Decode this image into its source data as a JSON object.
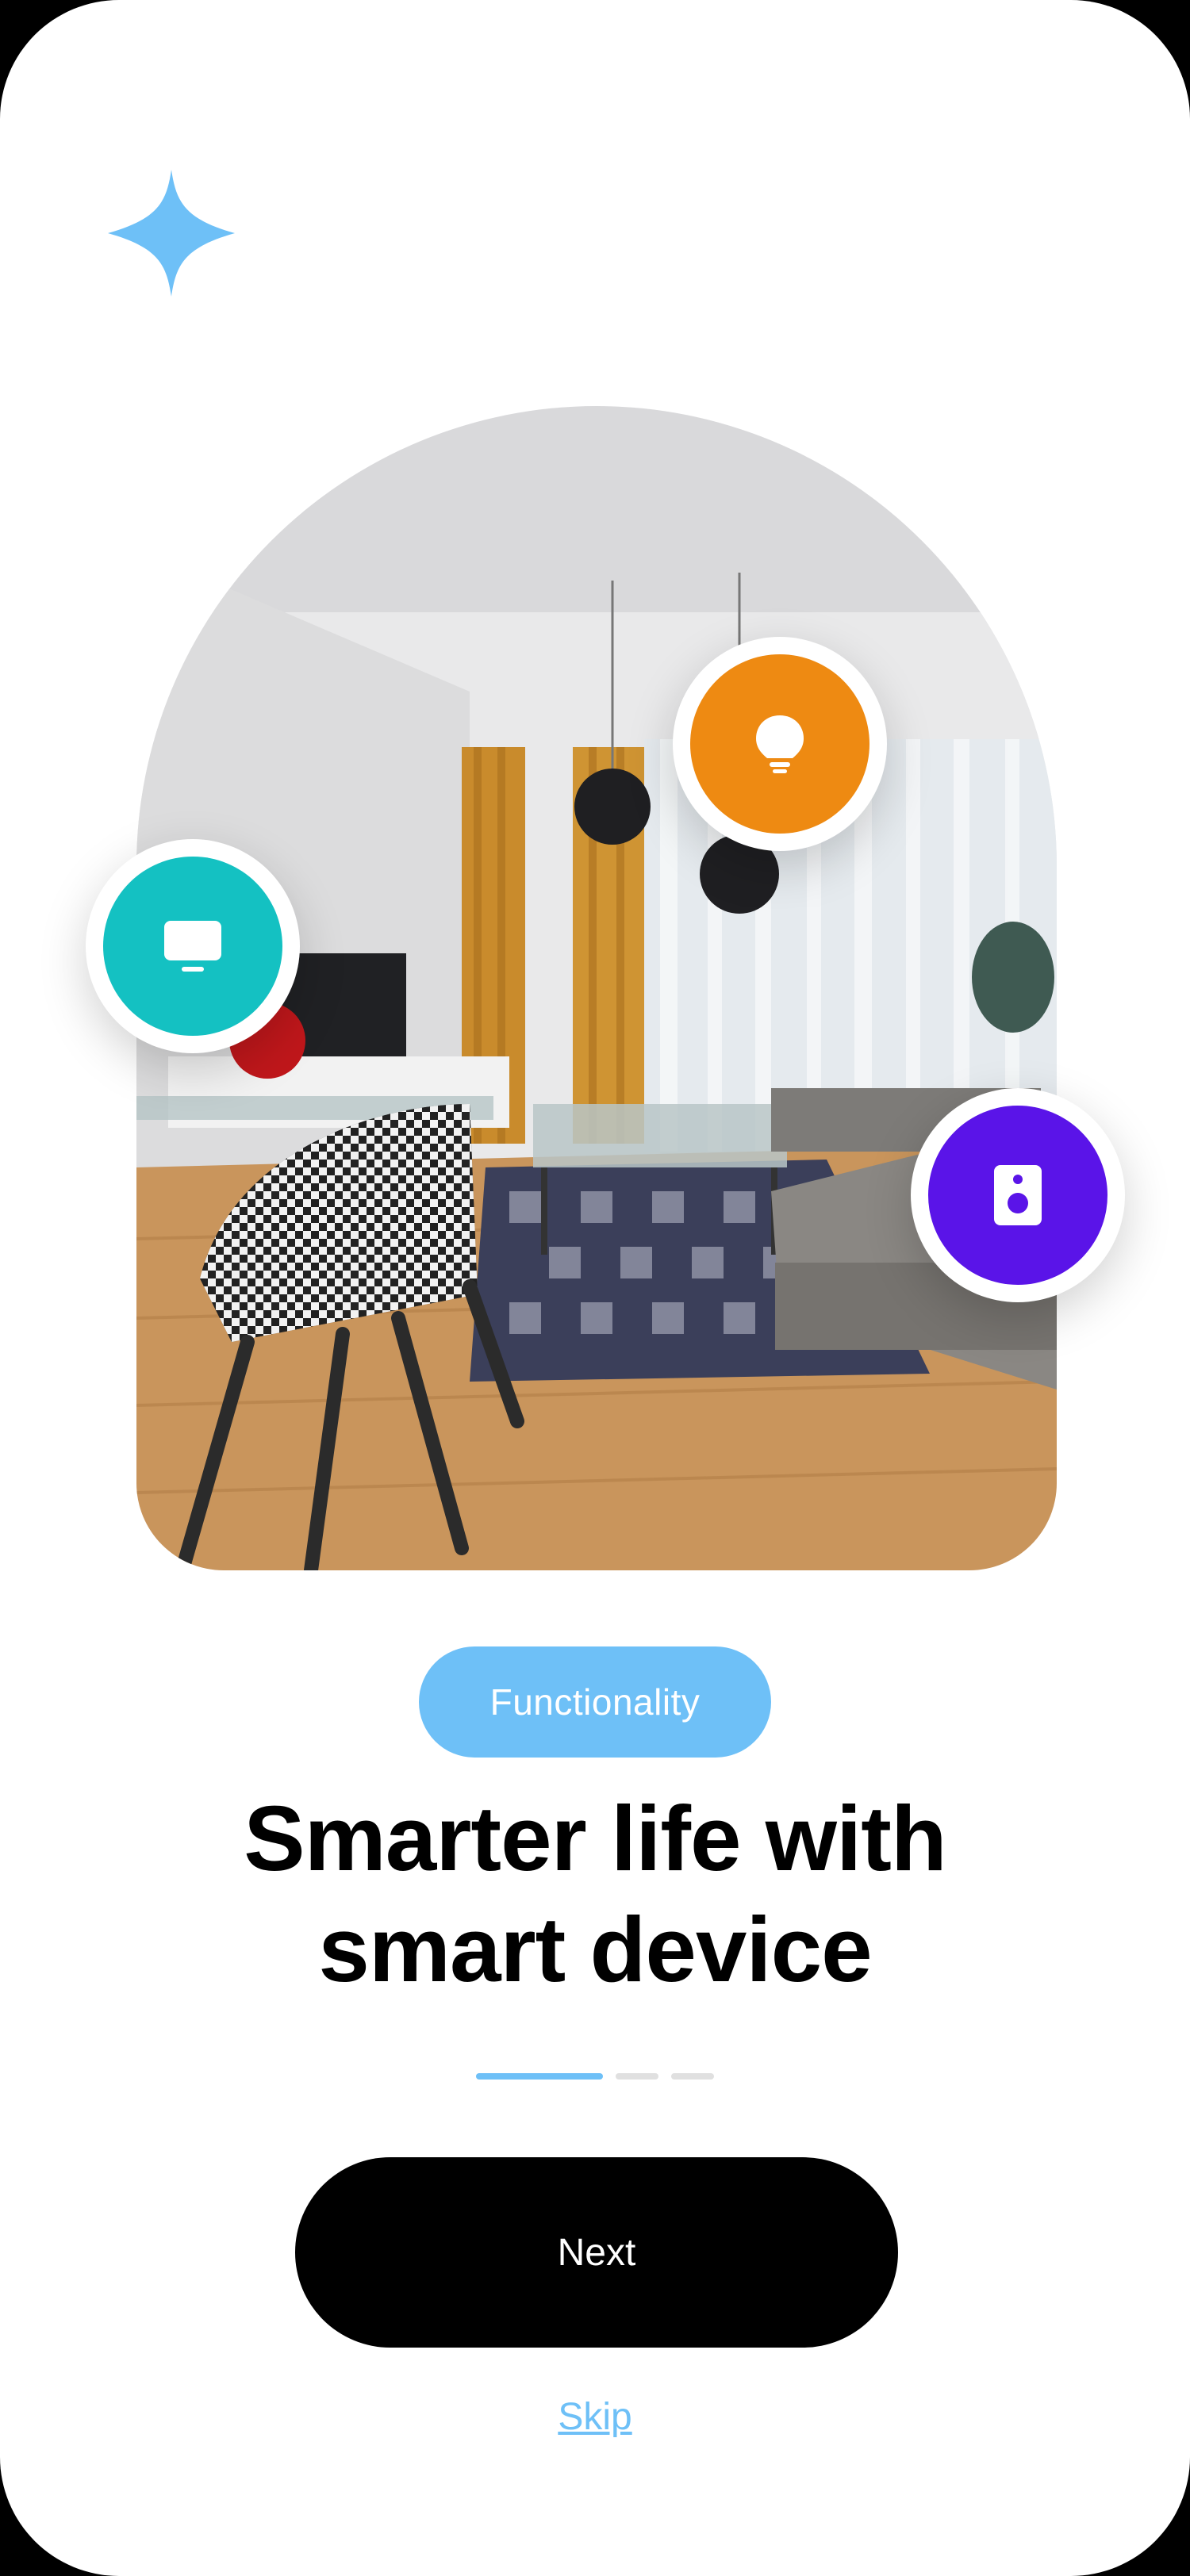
{
  "onboarding": {
    "chip_label": "Functionality",
    "headline_line1": "Smarter life with",
    "headline_line2": "smart device",
    "pagination": {
      "current": 1,
      "total": 3
    },
    "next_label": "Next",
    "skip_label": "Skip"
  },
  "devices": [
    {
      "name": "tv",
      "icon": "tv-icon",
      "color": "#14c1c2"
    },
    {
      "name": "light",
      "icon": "lightbulb-icon",
      "color": "#ee8a12"
    },
    {
      "name": "speaker",
      "icon": "speaker-icon",
      "color": "#5a14e8"
    }
  ],
  "colors": {
    "accent": "#6ec0f7",
    "primary_button": "#000000",
    "background": "#ffffff"
  }
}
